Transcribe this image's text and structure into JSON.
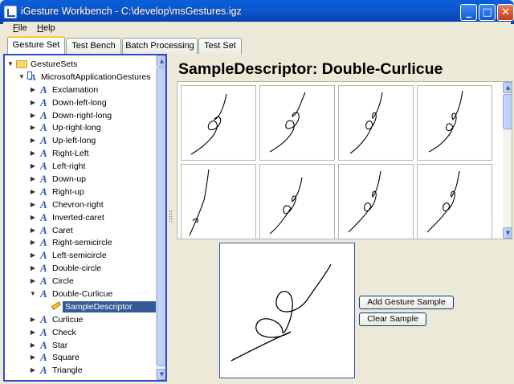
{
  "window": {
    "title": "iGesture Workbench - C:\\develop\\msGestures.igz",
    "controls": {
      "minimize": "_",
      "maximize": "□",
      "close": "✕"
    }
  },
  "menu": {
    "items": [
      "File",
      "Help"
    ]
  },
  "tabs": [
    {
      "label": "Gesture Set",
      "active": true
    },
    {
      "label": "Test Bench",
      "active": false
    },
    {
      "label": "Batch Processing",
      "active": false
    },
    {
      "label": "Test Set",
      "active": false
    }
  ],
  "tree": {
    "root": "GestureSets",
    "set": "MicrosoftApplicationGestures",
    "classes": [
      "Exclamation",
      "Down-left-long",
      "Down-right-long",
      "Up-right-long",
      "Up-left-long",
      "Right-Left",
      "Left-right",
      "Down-up",
      "Right-up",
      "Chevron-right",
      "Inverted-caret",
      "Caret",
      "Right-semicircle",
      "Left-semicircle",
      "Double-circle",
      "Circle",
      "Double-Curlicue"
    ],
    "expanded_class": "Double-Curlicue",
    "selected_child": "SampleDescriptor",
    "classes_after": [
      "Curlicue",
      "Check",
      "Star",
      "Square",
      "Triangle"
    ]
  },
  "descriptor": {
    "title": "SampleDescriptor: Double-Curlicue",
    "sample_count_visible": 8
  },
  "buttons": {
    "add_sample": "Add Gesture Sample",
    "clear_sample": "Clear Sample"
  },
  "icons": {
    "collapsed": "triangle-right",
    "expanded": "triangle-down",
    "gesture_class": "italic-a-icon",
    "gesture_set": "set-icon",
    "folder": "folder-icon",
    "descriptor": "pencil-icon"
  },
  "colors": {
    "selection": "#335c97",
    "tab_accent": "#ffc73c",
    "title_bar": "#0a5fd8"
  }
}
